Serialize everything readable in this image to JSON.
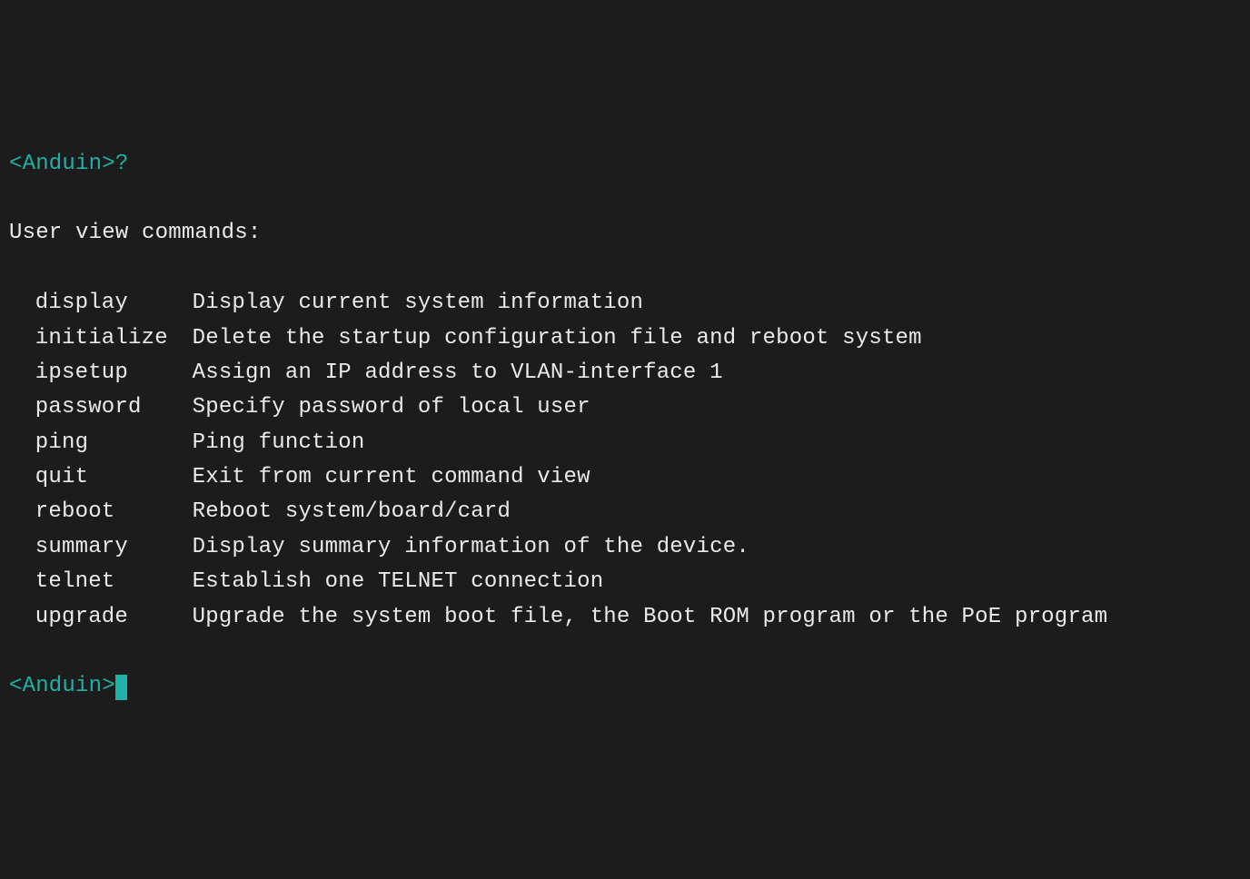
{
  "prompt_line_1": "<Anduin>?",
  "section_header": "User view commands:",
  "commands": [
    {
      "name": "display",
      "desc": "Display current system information"
    },
    {
      "name": "initialize",
      "desc": "Delete the startup configuration file and reboot system"
    },
    {
      "name": "ipsetup",
      "desc": "Assign an IP address to VLAN-interface 1"
    },
    {
      "name": "password",
      "desc": "Specify password of local user"
    },
    {
      "name": "ping",
      "desc": "Ping function"
    },
    {
      "name": "quit",
      "desc": "Exit from current command view"
    },
    {
      "name": "reboot",
      "desc": "Reboot system/board/card"
    },
    {
      "name": "summary",
      "desc": "Display summary information of the device."
    },
    {
      "name": "telnet",
      "desc": "Establish one TELNET connection"
    },
    {
      "name": "upgrade",
      "desc": "Upgrade the system boot file, the Boot ROM program or the PoE program"
    }
  ],
  "prompt_line_2": "<Anduin>"
}
